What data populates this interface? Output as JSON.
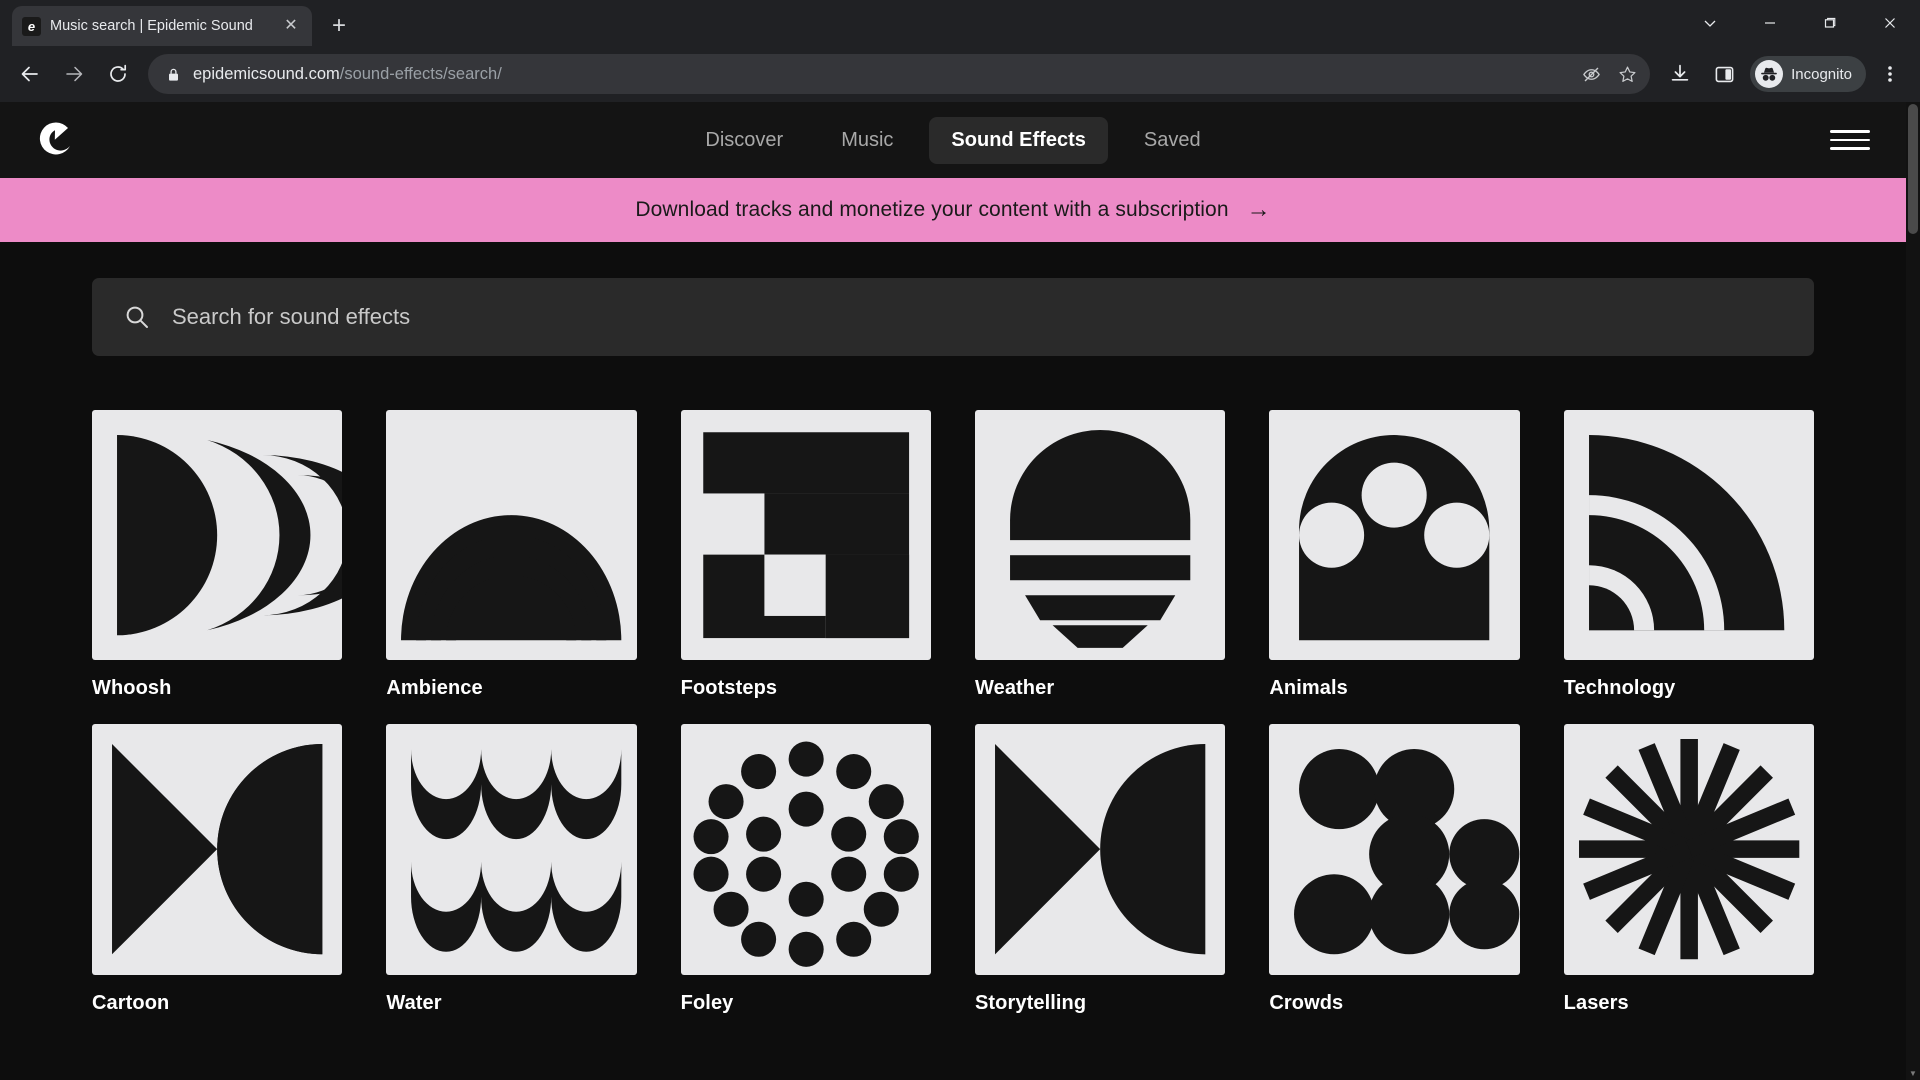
{
  "browser": {
    "tab": {
      "title": "Music search | Epidemic Sound",
      "favicon_glyph": "e",
      "favicon_name": "epidemic-sound-favicon",
      "close_glyph": "✕"
    },
    "new_tab_glyph": "+",
    "window_controls": {
      "chevron_name": "chevron-down-icon",
      "minimize_name": "minimize-icon",
      "maximize_name": "maximize-icon",
      "close_name": "close-window-icon"
    },
    "nav": {
      "back_name": "back-arrow-icon",
      "forward_name": "forward-arrow-icon",
      "reload_name": "reload-icon"
    },
    "omnibox": {
      "lock_name": "lock-icon",
      "url_domain": "epidemicsound.com",
      "url_path": "/sound-effects/search/",
      "tracking_protection_name": "eye-slash-icon",
      "bookmark_name": "star-icon"
    },
    "toolbar": {
      "download_name": "download-icon",
      "side_panel_name": "side-panel-icon",
      "incognito_label": "Incognito",
      "incognito_avatar_name": "incognito-avatar-icon",
      "menu_name": "three-dot-menu-icon"
    }
  },
  "site": {
    "logo_name": "epidemic-sound-logo",
    "nav": [
      {
        "label": "Discover",
        "active": false
      },
      {
        "label": "Music",
        "active": false
      },
      {
        "label": "Sound Effects",
        "active": true
      },
      {
        "label": "Saved",
        "active": false
      }
    ],
    "menu_name": "hamburger-menu-icon",
    "banner": {
      "text": "Download tracks and monetize your content with a subscription",
      "arrow": "→",
      "background": "#ed8bc7",
      "text_color": "#1a1a1a"
    },
    "search": {
      "placeholder": "Search for sound effects",
      "value": "",
      "icon_name": "search-icon"
    },
    "categories": [
      {
        "label": "Whoosh",
        "icon": "whoosh-icon"
      },
      {
        "label": "Ambience",
        "icon": "ambience-icon"
      },
      {
        "label": "Footsteps",
        "icon": "footsteps-icon"
      },
      {
        "label": "Weather",
        "icon": "weather-icon"
      },
      {
        "label": "Animals",
        "icon": "animals-icon"
      },
      {
        "label": "Technology",
        "icon": "technology-icon"
      },
      {
        "label": "Cartoon",
        "icon": "cartoon-icon"
      },
      {
        "label": "Water",
        "icon": "water-icon"
      },
      {
        "label": "Foley",
        "icon": "foley-icon"
      },
      {
        "label": "Storytelling",
        "icon": "storytelling-icon"
      },
      {
        "label": "Crowds",
        "icon": "crowds-icon"
      },
      {
        "label": "Lasers",
        "icon": "lasers-icon"
      }
    ],
    "colors": {
      "page_background": "#0d0d0d",
      "header_background": "#141414",
      "tile_background": "#e8e8ea",
      "tile_foreground": "#161616",
      "accent_pink": "#ed8bc7"
    }
  }
}
